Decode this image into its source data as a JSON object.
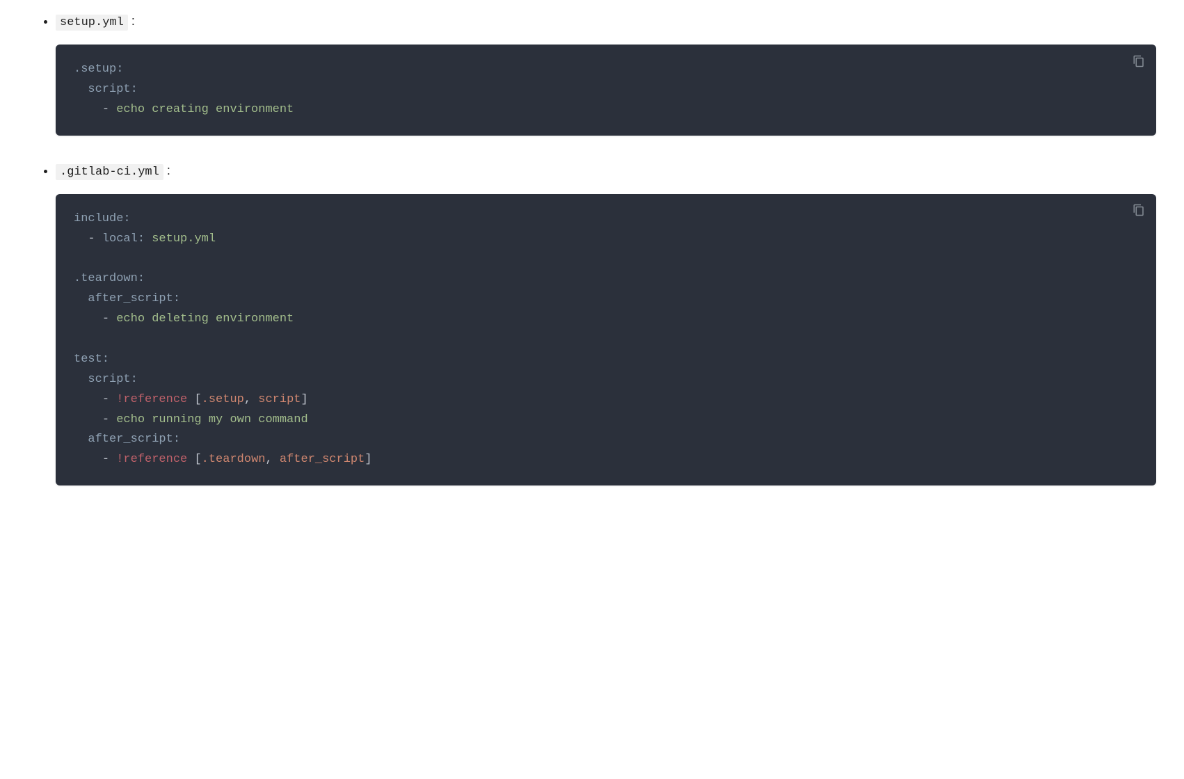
{
  "items": [
    {
      "filename": "setup.yml",
      "code": [
        [
          {
            "cls": "tok-key",
            "text": ".setup:"
          }
        ],
        [
          {
            "cls": "tok-indent",
            "text": "  "
          },
          {
            "cls": "tok-key",
            "text": "script:"
          }
        ],
        [
          {
            "cls": "tok-indent",
            "text": "    "
          },
          {
            "cls": "tok-punct",
            "text": "- "
          },
          {
            "cls": "tok-str",
            "text": "echo creating environment"
          }
        ]
      ]
    },
    {
      "filename": ".gitlab-ci.yml",
      "code": [
        [
          {
            "cls": "tok-key",
            "text": "include:"
          }
        ],
        [
          {
            "cls": "tok-indent",
            "text": "  "
          },
          {
            "cls": "tok-punct",
            "text": "- "
          },
          {
            "cls": "tok-key",
            "text": "local:"
          },
          {
            "cls": "tok-punct",
            "text": " "
          },
          {
            "cls": "tok-str",
            "text": "setup.yml"
          }
        ],
        [],
        [
          {
            "cls": "tok-key",
            "text": ".teardown:"
          }
        ],
        [
          {
            "cls": "tok-indent",
            "text": "  "
          },
          {
            "cls": "tok-key",
            "text": "after_script:"
          }
        ],
        [
          {
            "cls": "tok-indent",
            "text": "    "
          },
          {
            "cls": "tok-punct",
            "text": "- "
          },
          {
            "cls": "tok-str",
            "text": "echo deleting environment"
          }
        ],
        [],
        [
          {
            "cls": "tok-key",
            "text": "test:"
          }
        ],
        [
          {
            "cls": "tok-indent",
            "text": "  "
          },
          {
            "cls": "tok-key",
            "text": "script:"
          }
        ],
        [
          {
            "cls": "tok-indent",
            "text": "    "
          },
          {
            "cls": "tok-punct",
            "text": "- "
          },
          {
            "cls": "tok-tag",
            "text": "!reference"
          },
          {
            "cls": "tok-punct",
            "text": " ["
          },
          {
            "cls": "tok-orange",
            "text": ".setup"
          },
          {
            "cls": "tok-punct",
            "text": ", "
          },
          {
            "cls": "tok-orange",
            "text": "script"
          },
          {
            "cls": "tok-punct",
            "text": "]"
          }
        ],
        [
          {
            "cls": "tok-indent",
            "text": "    "
          },
          {
            "cls": "tok-punct",
            "text": "- "
          },
          {
            "cls": "tok-str",
            "text": "echo running my own command"
          }
        ],
        [
          {
            "cls": "tok-indent",
            "text": "  "
          },
          {
            "cls": "tok-key",
            "text": "after_script:"
          }
        ],
        [
          {
            "cls": "tok-indent",
            "text": "    "
          },
          {
            "cls": "tok-punct",
            "text": "- "
          },
          {
            "cls": "tok-tag",
            "text": "!reference"
          },
          {
            "cls": "tok-punct",
            "text": " ["
          },
          {
            "cls": "tok-orange",
            "text": ".teardown"
          },
          {
            "cls": "tok-punct",
            "text": ", "
          },
          {
            "cls": "tok-orange",
            "text": "after_script"
          },
          {
            "cls": "tok-punct",
            "text": "]"
          }
        ]
      ]
    }
  ]
}
